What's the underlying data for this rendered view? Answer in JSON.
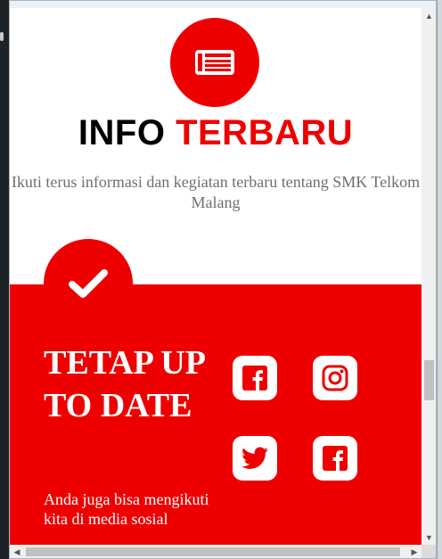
{
  "info": {
    "title_part1": "INFO",
    "title_part2": "TERBARU",
    "description": "Ikuti terus informasi dan kegiatan terbaru tentang SMK Telkom Malang"
  },
  "follow": {
    "title": "TETAP UP TO DATE",
    "text": "Anda juga bisa mengikuti kita di media sosial"
  },
  "social": [
    {
      "icon": "facebook-icon"
    },
    {
      "icon": "instagram-icon"
    },
    {
      "icon": "twitter-icon"
    },
    {
      "icon": "facebook-icon"
    }
  ],
  "icons": {
    "news_badge": "newspaper-icon",
    "check_badge": "check-icon"
  },
  "colors": {
    "accent": "#ee0000",
    "text_dark": "#000000",
    "text_muted": "#6f6f6f",
    "white": "#ffffff"
  }
}
